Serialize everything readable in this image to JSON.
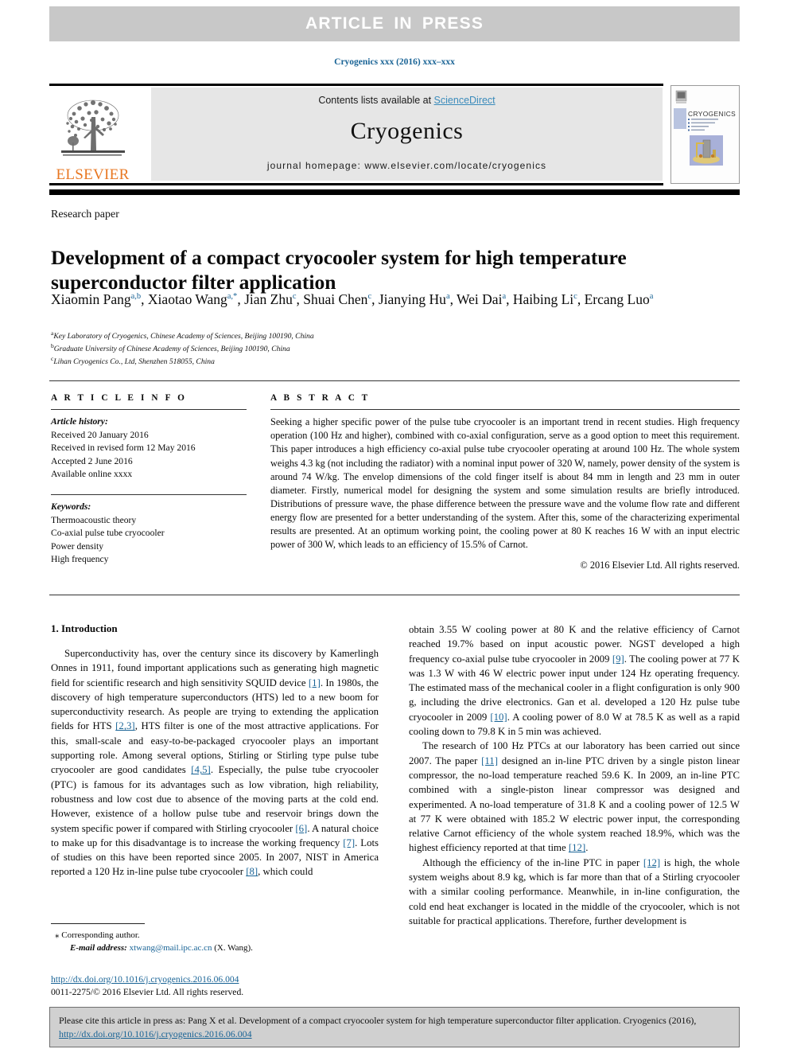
{
  "banner": {
    "label": "ARTICLE IN PRESS"
  },
  "running_head": "Cryogenics xxx (2016) xxx–xxx",
  "masthead": {
    "contents_prefix": "Contents lists available at ",
    "sciencedirect": "ScienceDirect",
    "journal_name": "Cryogenics",
    "homepage": "journal homepage: www.elsevier.com/locate/cryogenics",
    "publisher_wordmark": "ELSEVIER",
    "cover_journal_title": "CRYOGENICS",
    "accent_orange": "#e87722",
    "link_blue": "#1a6496"
  },
  "article": {
    "type_label": "Research paper",
    "title": "Development of a compact cryocooler system for high temperature superconductor filter application",
    "authors_html": "Xiaomin Pang<sup>a,b</sup>, Xiaotao Wang<sup>a,*</sup>, Jian Zhu<sup>c</sup>, Shuai Chen<sup>c</sup>, Jianying Hu<sup>a</sup>, Wei Dai<sup>a</sup>, Haibing Li<sup>c</sup>, Ercang Luo<sup>a</sup>",
    "affiliations": [
      "Key Laboratory of Cryogenics, Chinese Academy of Sciences, Beijing 100190, China",
      "Graduate University of Chinese Academy of Sciences, Beijing 100190, China",
      "Lihan Cryogenics Co., Ltd, Shenzhen 518055, China"
    ],
    "affiliation_markers": [
      "a",
      "b",
      "c"
    ]
  },
  "article_info": {
    "heading": "A R T I C L E   I N F O",
    "history_label": "Article history:",
    "history": [
      "Received 20 January 2016",
      "Received in revised form 12 May 2016",
      "Accepted 2 June 2016",
      "Available online xxxx"
    ],
    "keywords_label": "Keywords:",
    "keywords": [
      "Thermoacoustic theory",
      "Co-axial pulse tube cryocooler",
      "Power density",
      "High frequency"
    ]
  },
  "abstract": {
    "heading": "A B S T R A C T",
    "body": "Seeking a higher specific power of the pulse tube cryocooler is an important trend in recent studies. High frequency operation (100 Hz and higher), combined with co-axial configuration, serve as a good option to meet this requirement. This paper introduces a high efficiency co-axial pulse tube cryocooler operating at around 100 Hz. The whole system weighs 4.3 kg (not including the radiator) with a nominal input power of 320 W, namely, power density of the system is around 74 W/kg. The envelop dimensions of the cold finger itself is about 84 mm in length and 23 mm in outer diameter. Firstly, numerical model for designing the system and some simulation results are briefly introduced. Distributions of pressure wave, the phase difference between the pressure wave and the volume flow rate and different energy flow are presented for a better understanding of the system. After this, some of the characterizing experimental results are presented. At an optimum working point, the cooling power at 80 K reaches 16 W with an input electric power of 300 W, which leads to an efficiency of 15.5% of Carnot.",
    "copyright": "© 2016 Elsevier Ltd. All rights reserved."
  },
  "body": {
    "section_title": "1. Introduction",
    "left_paragraphs": [
      {
        "segments": [
          {
            "t": "Superconductivity has, over the century since its discovery by Kamerlingh Onnes in 1911, found important applications such as generating high magnetic field for scientific research and high sensitivity SQUID device ",
            "ref": false
          },
          {
            "t": "[1]",
            "ref": true
          },
          {
            "t": ". In 1980s, the discovery of high temperature superconductors (HTS) led to a new boom for superconductivity research. As people are trying to extending the application fields for HTS ",
            "ref": false
          },
          {
            "t": "[2,3]",
            "ref": true
          },
          {
            "t": ", HTS filter is one of the most attractive applications. For this, small-scale and easy-to-be-packaged cryocooler plays an important supporting role. Among several options, Stirling or Stirling type pulse tube cryocooler are good candidates ",
            "ref": false
          },
          {
            "t": "[4,5]",
            "ref": true
          },
          {
            "t": ". Especially, the pulse tube cryocooler (PTC) is famous for its advantages such as low vibration, high reliability, robustness and low cost due to absence of the moving parts at the cold end. However, existence of a hollow pulse tube and reservoir brings down the system specific power if compared with Stirling cryocooler ",
            "ref": false
          },
          {
            "t": "[6]",
            "ref": true
          },
          {
            "t": ". A natural choice to make up for this disadvantage is to increase the working frequency ",
            "ref": false
          },
          {
            "t": "[7]",
            "ref": true
          },
          {
            "t": ". Lots of studies on this have been reported since 2005. In 2007, NIST in America reported a 120 Hz in-line pulse tube cryocooler ",
            "ref": false
          },
          {
            "t": "[8]",
            "ref": true
          },
          {
            "t": ", which could",
            "ref": false
          }
        ]
      }
    ],
    "right_paragraphs": [
      {
        "indent": false,
        "segments": [
          {
            "t": "obtain 3.55 W cooling power at 80 K and the relative efficiency of Carnot reached 19.7% based on input acoustic power. NGST developed a high frequency co-axial pulse tube cryocooler in 2009 ",
            "ref": false
          },
          {
            "t": "[9]",
            "ref": true
          },
          {
            "t": ". The cooling power at 77 K was 1.3 W with 46 W electric power input under 124 Hz operating frequency. The estimated mass of the mechanical cooler in a flight configuration is only 900 g, including the drive electronics. Gan et al. developed a 120 Hz pulse tube cryocooler in 2009 ",
            "ref": false
          },
          {
            "t": "[10]",
            "ref": true
          },
          {
            "t": ". A cooling power of 8.0 W at 78.5 K as well as a rapid cooling down to 79.8 K in 5 min was achieved.",
            "ref": false
          }
        ]
      },
      {
        "indent": true,
        "segments": [
          {
            "t": "The research of 100 Hz PTCs at our laboratory has been carried out since 2007. The paper ",
            "ref": false
          },
          {
            "t": "[11]",
            "ref": true
          },
          {
            "t": " designed an in-line PTC driven by a single piston linear compressor, the no-load temperature reached 59.6 K. In 2009, an in-line PTC combined with a single-piston linear compressor was designed and experimented. A no-load temperature of 31.8 K and a cooling power of 12.5 W at 77 K were obtained with 185.2 W electric power input, the corresponding relative Carnot efficiency of the whole system reached 18.9%, which was the highest efficiency reported at that time ",
            "ref": false
          },
          {
            "t": "[12]",
            "ref": true
          },
          {
            "t": ".",
            "ref": false
          }
        ]
      },
      {
        "indent": true,
        "segments": [
          {
            "t": "Although the efficiency of the in-line PTC in paper ",
            "ref": false
          },
          {
            "t": "[12]",
            "ref": true
          },
          {
            "t": " is high, the whole system weighs about 8.9 kg, which is far more than that of a Stirling cryocooler with a similar cooling performance. Meanwhile, in in-line configuration, the cold end heat exchanger is located in the middle of the cryocooler, which is not suitable for practical applications. Therefore, further development is",
            "ref": false
          }
        ]
      }
    ]
  },
  "footnote": {
    "marker": "⁎",
    "corresponding": "Corresponding author.",
    "email_label": "E-mail address:",
    "email": "xtwang@mail.ipc.ac.cn",
    "email_owner": "(X. Wang)."
  },
  "publication_footer": {
    "doi_url": "http://dx.doi.org/10.1016/j.cryogenics.2016.06.004",
    "issn_line": "0011-2275/© 2016 Elsevier Ltd. All rights reserved."
  },
  "citation_box": {
    "text_before": "Please cite this article in press as: Pang X et al. Development of a compact cryocooler system for high temperature superconductor filter application. Cryogenics (2016), ",
    "doi": "http://dx.doi.org/10.1016/j.cryogenics.2016.06.004"
  }
}
